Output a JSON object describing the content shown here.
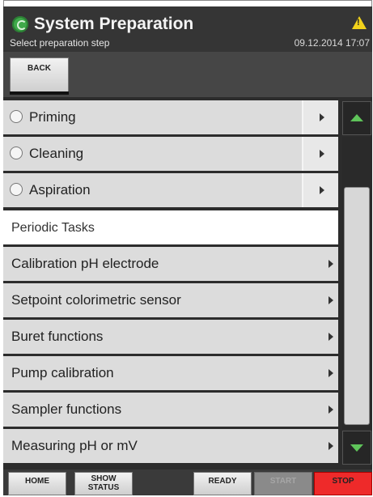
{
  "header": {
    "title": "System Preparation",
    "subtitle": "Select preparation step",
    "datetime": "09.12.2014 17:07",
    "logo_icon": "recycle-logo-icon",
    "warning_icon": "warning-triangle-icon"
  },
  "toolbar": {
    "back_label": "BACK"
  },
  "preparation_steps": [
    {
      "label": "Priming"
    },
    {
      "label": "Cleaning"
    },
    {
      "label": "Aspiration"
    }
  ],
  "periodic_section_title": "Periodic Tasks",
  "periodic_tasks": [
    {
      "label": "Calibration pH electrode"
    },
    {
      "label": "Setpoint colorimetric sensor"
    },
    {
      "label": "Buret functions"
    },
    {
      "label": "Pump calibration"
    },
    {
      "label": "Sampler functions"
    },
    {
      "label": "Measuring pH or mV"
    }
  ],
  "bottom_bar": {
    "home_label": "HOME",
    "show_status_line1": "SHOW",
    "show_status_line2": "STATUS",
    "ready_label": "READY",
    "start_label": "START",
    "stop_label": "STOP"
  },
  "colors": {
    "accent_green": "#5fc45a",
    "stop_red": "#ee2a2a",
    "warning_yellow": "#f2d21b",
    "header_bg": "#353535"
  }
}
